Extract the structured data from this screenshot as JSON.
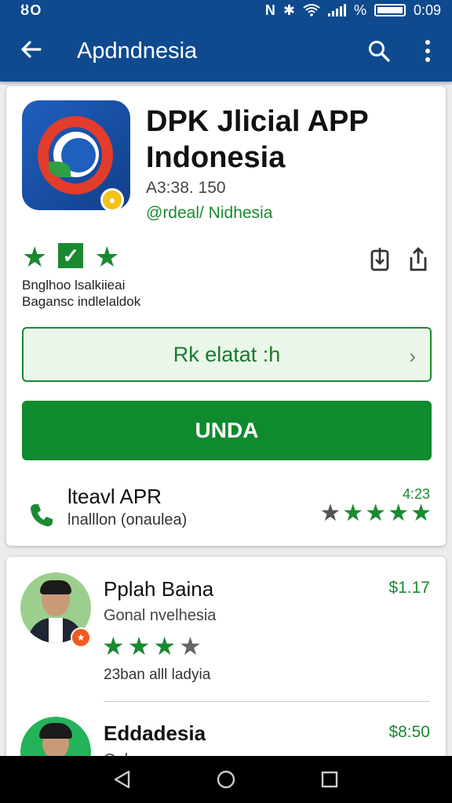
{
  "status_bar": {
    "left_text": "ȣO",
    "battery_text": "%",
    "time": "0:09",
    "icons": [
      "nfc-icon",
      "bluetooth-icon",
      "wifi-icon",
      "signal-icon",
      "battery-icon"
    ]
  },
  "app_bar": {
    "title": "Apdndnesia",
    "icons": [
      "back-arrow-icon",
      "search-icon",
      "more-vert-icon"
    ]
  },
  "app_detail": {
    "name": "DPK Jlicial APP Indonesia",
    "version": "A3:38. 150",
    "developer": "@rdeal/ Nidhesia",
    "meta_line_1": "Bnglhoo lsalkiieai",
    "meta_line_2": "Bagansc indlelaldok",
    "secondary_button": "Rk elatat :h",
    "primary_button": "UNDA",
    "info_title": "lteavl APR",
    "info_subtitle": "lnalllon (onaulea)",
    "info_price": "4:23",
    "info_rating": 4,
    "colors": {
      "primary": "#0f4a8f",
      "accent": "#1a8a30"
    }
  },
  "list": [
    {
      "name": "Pplah Baina",
      "subtitle": "Gonal nvelhesia",
      "price": "$1.17",
      "rating": 3,
      "description": "23ban alll ladyia",
      "badge_icon": "star-badge-icon"
    },
    {
      "name": "Eddadesia",
      "subtitle": "Gala...",
      "price": "$8:50"
    }
  ],
  "nav_bar": {
    "icons": [
      "nav-back-icon",
      "nav-home-icon",
      "nav-recents-icon"
    ]
  }
}
